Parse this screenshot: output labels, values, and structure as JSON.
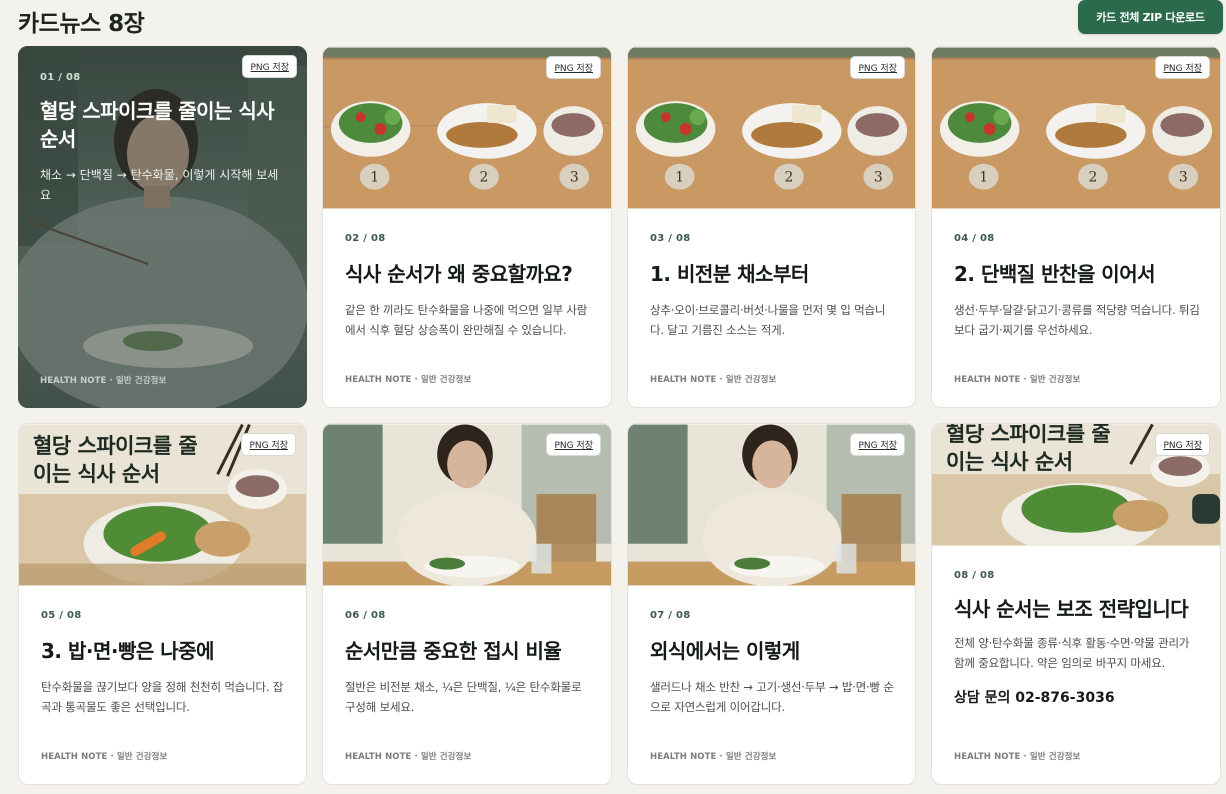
{
  "header": {
    "title": "카드뉴스 8장",
    "zip_button": "카드 전체 ZIP 다운로드"
  },
  "png_label": "PNG 저장",
  "footer_label": "HEALTH NOTE · 일반 건강정보",
  "plate_labels": [
    "1",
    "2",
    "3"
  ],
  "cards": [
    {
      "num": "01 / 08",
      "title": "혈당 스파이크를 줄이는 식사 순서",
      "desc": "채소 → 단백질 → 탄수화물, 이렇게 시작해 보세요"
    },
    {
      "num": "02 / 08",
      "title": "식사 순서가 왜 중요할까요?",
      "desc": "같은 한 끼라도 탄수화물을 나중에 먹으면 일부 사람에서 식후 혈당 상승폭이 완만해질 수 있습니다."
    },
    {
      "num": "03 / 08",
      "title": "1. 비전분 채소부터",
      "desc": "상추·오이·브로콜리·버섯·나물을 먼저 몇 입 먹습니다. 달고 기름진 소스는 적게."
    },
    {
      "num": "04 / 08",
      "title": "2. 단백질 반찬을 이어서",
      "desc": "생선·두부·달걀·닭고기·콩류를 적당량 먹습니다. 튀김보다 굽기·찌기를 우선하세요."
    },
    {
      "num": "05 / 08",
      "title": "3. 밥·면·빵은 나중에",
      "desc": "탄수화물을 끊기보다 양을 정해 천천히 먹습니다. 잡곡과 통곡물도 좋은 선택입니다.",
      "photo_title": "혈당 스파이크를 줄이는 식사 순서"
    },
    {
      "num": "06 / 08",
      "title": "순서만큼 중요한 접시 비율",
      "desc": "절반은 비전분 채소, ¼은 단백질, ¼은 탄수화물로 구성해 보세요."
    },
    {
      "num": "07 / 08",
      "title": "외식에서는 이렇게",
      "desc": "샐러드나 채소 반찬 → 고기·생선·두부 → 밥·면·빵 순으로 자연스럽게 이어갑니다."
    },
    {
      "num": "08 / 08",
      "title": "식사 순서는 보조 전략입니다",
      "desc": "전체 양·탄수화물 종류·식후 활동·수면·약물 관리가 함께 중요합니다. 약은 임의로 바꾸지 마세요.",
      "phone": "상담 문의 02-876-3036",
      "photo_title": "혈당 스파이크를 줄이는 식사 순서"
    }
  ]
}
